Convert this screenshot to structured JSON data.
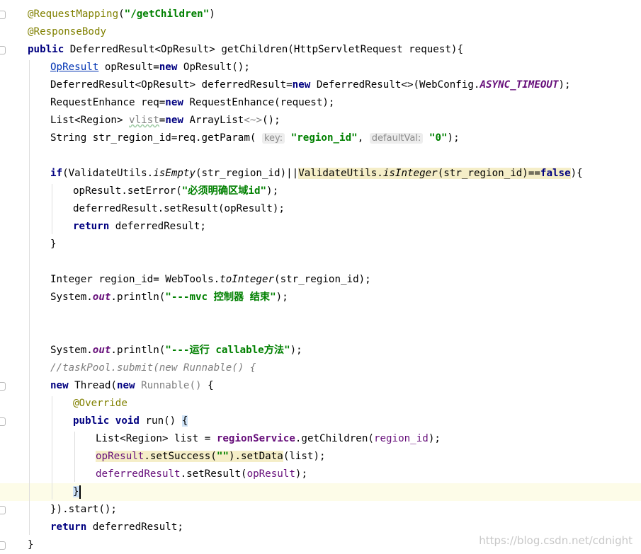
{
  "editor": {
    "lines": [
      {
        "indent": 1,
        "html": "<span class=\"ann\">@RequestMapping</span>(<span class=\"str\">\"/getChildren\"</span>)"
      },
      {
        "indent": 1,
        "html": "<span class=\"ann\">@ResponseBody</span>"
      },
      {
        "indent": 1,
        "html": "<span class=\"kw\">public</span> DeferredResult&lt;OpResult&gt; getChildren(HttpServletRequest request){"
      },
      {
        "indent": 2,
        "html": "<span class=\"lnk\">OpResult</span> opResult=<span class=\"kw\">new</span> OpResult();"
      },
      {
        "indent": 2,
        "html": "DeferredResult&lt;OpResult&gt; deferredResult=<span class=\"kw\">new</span> DeferredResult&lt;&gt;(WebConfig.<span class=\"cst\">ASYNC_TIMEOUT</span>);"
      },
      {
        "indent": 2,
        "html": "RequestEnhance req=<span class=\"kw\">new</span> RequestEnhance(request);"
      },
      {
        "indent": 2,
        "html": "List&lt;Region&gt; <span class=\"gray wavy\">vlist</span>=<span class=\"kw\">new</span> ArrayList<span class=\"gray\">&lt;~&gt;</span>();"
      },
      {
        "indent": 2,
        "html": "String str_region_id=req.getParam( <span class=\"hint\">key:</span> <span class=\"str\">\"region_id\"</span>, <span class=\"hint\">defaultVal:</span> <span class=\"str\">\"0\"</span>);"
      },
      {
        "indent": 2,
        "html": ""
      },
      {
        "indent": 2,
        "html": "<span class=\"kw\">if</span>(ValidateUtils.<span class=\"it\">isEmpty</span>(str_region_id)||<span class=\"hl\">ValidateUtils.<span class=\"it\">isInteger</span>(str_region_id)==<span class=\"kw\">false</span></span>){"
      },
      {
        "indent": 3,
        "html": "opResult.setError(<span class=\"str\">\"必须明确区域id\"</span>);"
      },
      {
        "indent": 3,
        "html": "deferredResult.setResult(opResult);"
      },
      {
        "indent": 3,
        "html": "<span class=\"kw\">return</span> deferredResult;"
      },
      {
        "indent": 2,
        "html": "}"
      },
      {
        "indent": 2,
        "html": ""
      },
      {
        "indent": 2,
        "html": "Integer region_id= WebTools.<span class=\"it\">toInteger</span>(str_region_id);"
      },
      {
        "indent": 2,
        "html": "System.<span class=\"fieldi\">out</span>.println(<span class=\"str\">\"---mvc 控制器 结束\"</span>);"
      },
      {
        "indent": 2,
        "html": ""
      },
      {
        "indent": 2,
        "html": ""
      },
      {
        "indent": 2,
        "html": "System.<span class=\"fieldi\">out</span>.println(<span class=\"str\">\"---运行 callable方法\"</span>);"
      },
      {
        "indent": 2,
        "html": "<span class=\"cmt\">//taskPool.submit(new Runnable() {</span>"
      },
      {
        "indent": 2,
        "html": "<span class=\"kw\">new</span> Thread(<span class=\"kw\">new</span> <span class=\"gray\">Runnable()</span> {"
      },
      {
        "indent": 3,
        "html": "<span class=\"ann\">@Override</span>"
      },
      {
        "indent": 3,
        "html": "<span class=\"kw\">public void</span> run() <span class=\"bhl\">{</span>"
      },
      {
        "indent": 4,
        "html": "List&lt;Region&gt; list = <span class=\"fieldb\">regionService</span>.getChildren(<span class=\"field\">region_id</span>);"
      },
      {
        "indent": 4,
        "html": "<span class=\"hl\"><span class=\"field\">opResult</span>.setSuccess(<span class=\"str\">\"\"</span>).setData</span>(list);"
      },
      {
        "indent": 4,
        "html": "<span class=\"field\">deferredResult</span>.setResult(<span class=\"field\">opResult</span>);"
      },
      {
        "indent": 3,
        "html": "<span class=\"bhl\">}</span><span class=\"caret\"></span>",
        "current": true
      },
      {
        "indent": 2,
        "html": "}).start();"
      },
      {
        "indent": 2,
        "html": "<span class=\"kw\">return</span> deferredResult;"
      },
      {
        "indent": 1,
        "html": "}"
      }
    ]
  },
  "watermark": "https://blog.csdn.net/cdnight"
}
